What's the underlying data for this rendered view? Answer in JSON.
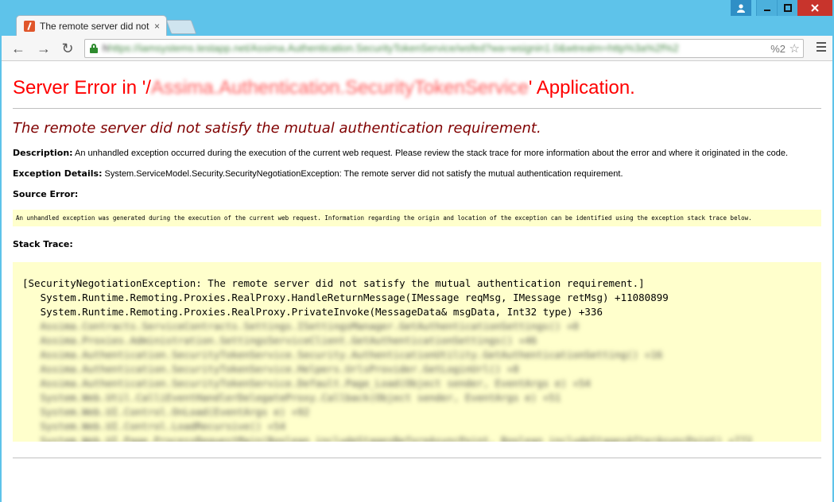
{
  "tab": {
    "title": "The remote server did not satisfy the mutual authentication requirement.",
    "close_glyph": "×"
  },
  "toolbar": {
    "back": "←",
    "forward": "→",
    "reload": "↻",
    "url_prefix": "h",
    "url_blurred": "https://iamsystems.testapp.net/Assima.Authentication.SecurityTokenService/wsfed?wa=wsignin1.0&wtrealm=http%3a%2f%2",
    "url_tail": "%2",
    "star": "☆"
  },
  "page": {
    "title_prefix": "Server Error in '/",
    "title_app": "Assima.Authentication.SecurityTokenService",
    "title_suffix": "' Application.",
    "error_heading": "The remote server did not satisfy the mutual authentication requirement.",
    "description_label": "Description:",
    "description_text": "An unhandled exception occurred during the execution of the current web request. Please review the stack trace for more information about the error and where it originated in the code.",
    "exception_label": "Exception Details:",
    "exception_text": "System.ServiceModel.Security.SecurityNegotiationException: The remote server did not satisfy the mutual authentication requirement.",
    "source_label": "Source Error:",
    "source_text": "An unhandled exception was generated during the execution of the current web request. Information regarding the origin and location of the exception can be identified using the exception stack trace below.",
    "stack_label": "Stack Trace:",
    "stack_visible": [
      "[SecurityNegotiationException: The remote server did not satisfy the mutual authentication requirement.]",
      "   System.Runtime.Remoting.Proxies.RealProxy.HandleReturnMessage(IMessage reqMsg, IMessage retMsg) +11080899",
      "   System.Runtime.Remoting.Proxies.RealProxy.PrivateInvoke(MessageData& msgData, Int32 type) +336"
    ],
    "stack_blurred": [
      "   Assima.Contracts.ServiceContracts.Settings.ISettingsManager.GetAuthenticationSettings() +0",
      "   Assima.Proxies.Administration.SettingsServiceClient.GetAuthenticationSettings() +46",
      "   Assima.Authentication.SecurityTokenService.Security.AuthenticationUtility.GetAuthenticationSetting() +16",
      "   Assima.Authentication.SecurityTokenService.Helpers.UrlsProvider.GetLoginUrl() +8",
      "   Assima.Authentication.SecurityTokenService.Default.Page_Load(Object sender, EventArgs e) +54",
      "   System.Web.Util.CalliEventHandlerDelegateProxy.Callback(Object sender, EventArgs e) +51",
      "   System.Web.UI.Control.OnLoad(EventArgs e) +92",
      "   System.Web.UI.Control.LoadRecursive() +54",
      "   System.Web.UI.Page.ProcessRequestMain(Boolean includeStagesBeforeAsyncPoint, Boolean includeStagesAfterAsyncPoint) +772"
    ]
  }
}
